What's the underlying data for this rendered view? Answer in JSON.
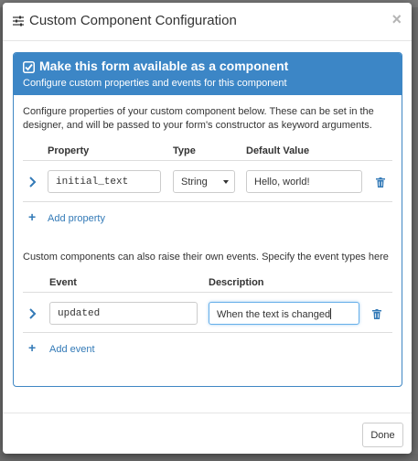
{
  "modal": {
    "title": "Custom Component Configuration",
    "close_label": "×"
  },
  "panel": {
    "title": "Make this form available as a component",
    "subtitle": "Configure custom properties and events for this component"
  },
  "properties": {
    "description_line1": "Configure properties of your custom component below. These can be set in the",
    "description_line2": "designer, and will be passed to your form's constructor as keyword arguments.",
    "columns": [
      "Property",
      "Type",
      "Default Value"
    ],
    "rows": [
      {
        "name": "initial_text",
        "type": "String",
        "default": "Hello, world!"
      }
    ],
    "add_label": "Add property"
  },
  "events": {
    "description": "Custom components can also raise their own events. Specify the event types here",
    "columns": [
      "Event",
      "Description"
    ],
    "rows": [
      {
        "name": "updated",
        "description": "When the text is changed"
      }
    ],
    "add_label": "Add event"
  },
  "footer": {
    "done_label": "Done"
  },
  "icons": {
    "config": "sliders-icon",
    "check": "checkbox-checked-icon",
    "expand": "chevron-right-icon",
    "delete": "trash-icon",
    "add": "plus-icon"
  },
  "colors": {
    "accent": "#3c86c6",
    "link": "#337ab7"
  }
}
